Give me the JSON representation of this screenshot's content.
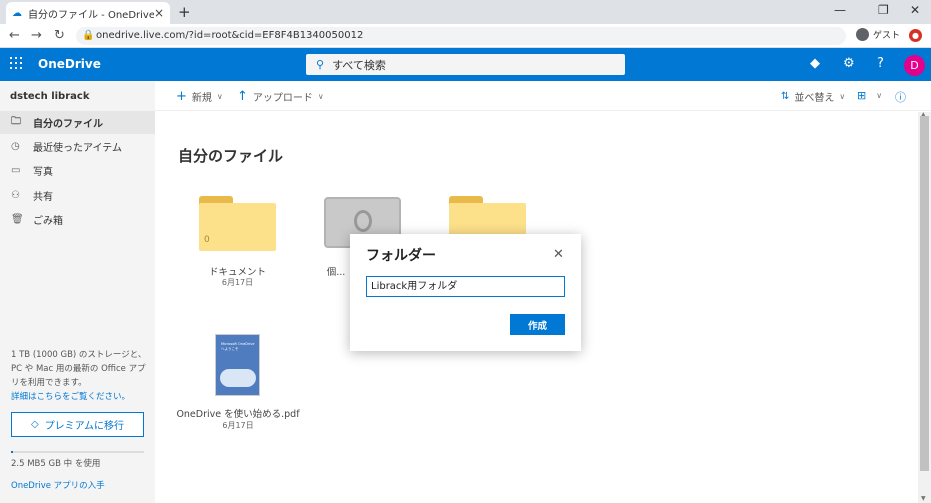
{
  "browser": {
    "tab_title": "自分のファイル - OneDrive",
    "url": "onedrive.live.com/?id=root&cid=EF8F4B1340050012",
    "guest_label": "ゲスト"
  },
  "header": {
    "brand": "OneDrive",
    "search_placeholder": "すべて検索",
    "avatar_letter": "D"
  },
  "sidebar": {
    "username": "dstech librack",
    "items": [
      {
        "label": "自分のファイル",
        "icon": "folder-icon"
      },
      {
        "label": "最近使ったアイテム",
        "icon": "clock-icon"
      },
      {
        "label": "写真",
        "icon": "photo-icon"
      },
      {
        "label": "共有",
        "icon": "people-icon"
      },
      {
        "label": "ごみ箱",
        "icon": "trash-icon"
      }
    ],
    "storage_info": "1 TB (1000 GB) のストレージと、PC や Mac 用の最新の Office アプリを利用できます。",
    "storage_link": "詳細はこちらをご覧ください。",
    "premium_button": "プレミアムに移行",
    "storage_used": "2.5 MB5 GB 中 を使用",
    "get_apps": "OneDrive アプリの入手"
  },
  "commandbar": {
    "new_label": "新規",
    "upload_label": "アップロード",
    "sort_label": "並べ替え"
  },
  "main": {
    "title": "自分のファイル",
    "files": [
      {
        "name": "ドキュメント",
        "date": "6月17日",
        "count": "0"
      },
      {
        "name": "個人用 Vault",
        "visible_name": "個..."
      },
      {
        "name": ""
      },
      {
        "name": "OneDrive を使い始める.pdf",
        "date": "6月17日",
        "thumb_text": "Microsoft OneDrive へようこそ"
      }
    ]
  },
  "dialog": {
    "title": "フォルダー",
    "input_value": "Librack用フォルダ",
    "create_button": "作成"
  }
}
